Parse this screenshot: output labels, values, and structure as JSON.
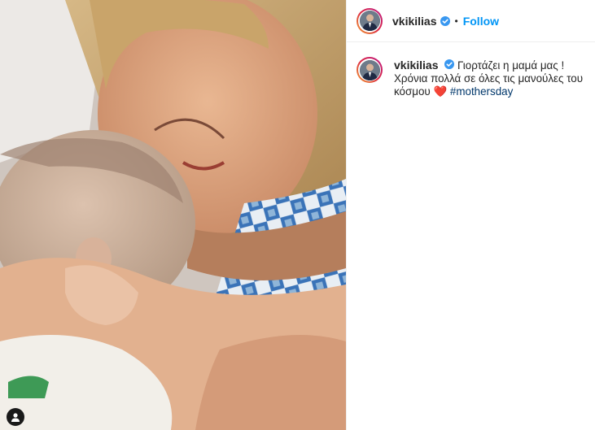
{
  "post": {
    "username": "vkikilias",
    "separator": "•",
    "follow_label": "Follow",
    "caption_line1": "Γιορτάζει η μαμά μας !",
    "caption_line2": "Χρόνια πολλά σε όλες τις μανούλες του κόσμου",
    "caption_heart": "❤️",
    "hashtag": "#mothersday"
  },
  "icons": {
    "verified": "verified-badge-icon",
    "user_tag": "user-tag-icon"
  },
  "colors": {
    "link_blue": "#0095f6",
    "hashtag": "#00376b",
    "verified": "#3897f0"
  }
}
